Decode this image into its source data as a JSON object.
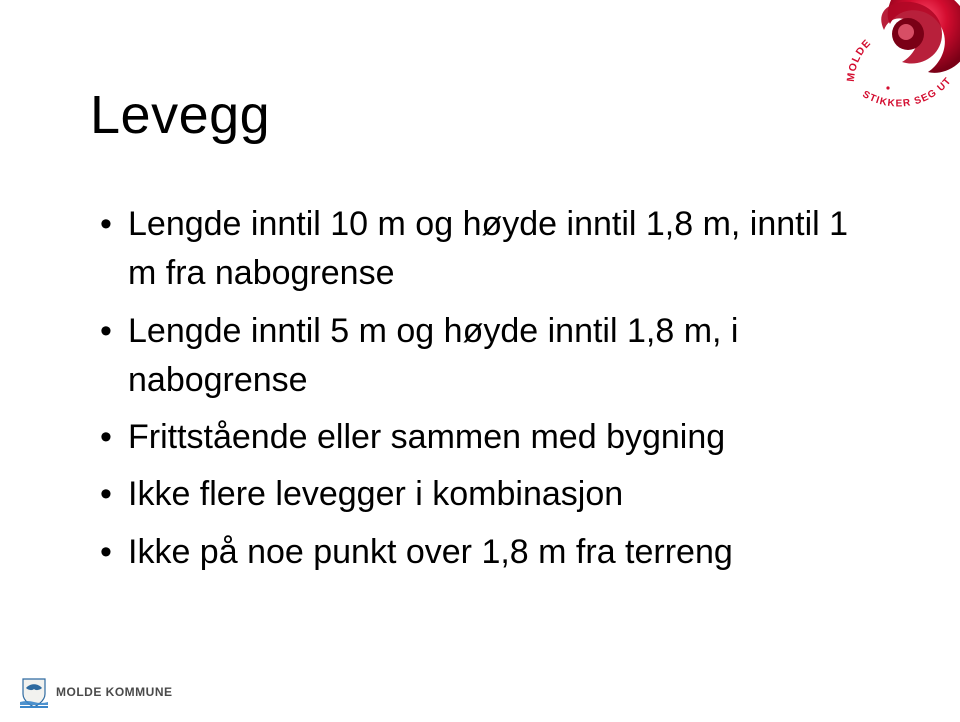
{
  "title": "Levegg",
  "bullets": [
    "Lengde inntil 10 m og høyde inntil 1,8 m, inntil 1 m fra nabogrense",
    "Lengde inntil 5 m og høyde inntil 1,8 m, i nabogrense",
    "Frittstående eller sammen med bygning",
    "Ikke flere levegger i kombinasjon",
    "Ikke på noe punkt over 1,8 m fra terreng"
  ],
  "footer": {
    "org": "MOLDE KOMMUNE"
  },
  "rose": {
    "top_text": "MOLDE",
    "bottom_text": "STIKKER SEG UT"
  },
  "colors": {
    "rose_red": "#d30c2f",
    "rose_dark": "#7a0016",
    "crest_blue": "#2e6aa0",
    "crest_water": "#3b86c9"
  }
}
